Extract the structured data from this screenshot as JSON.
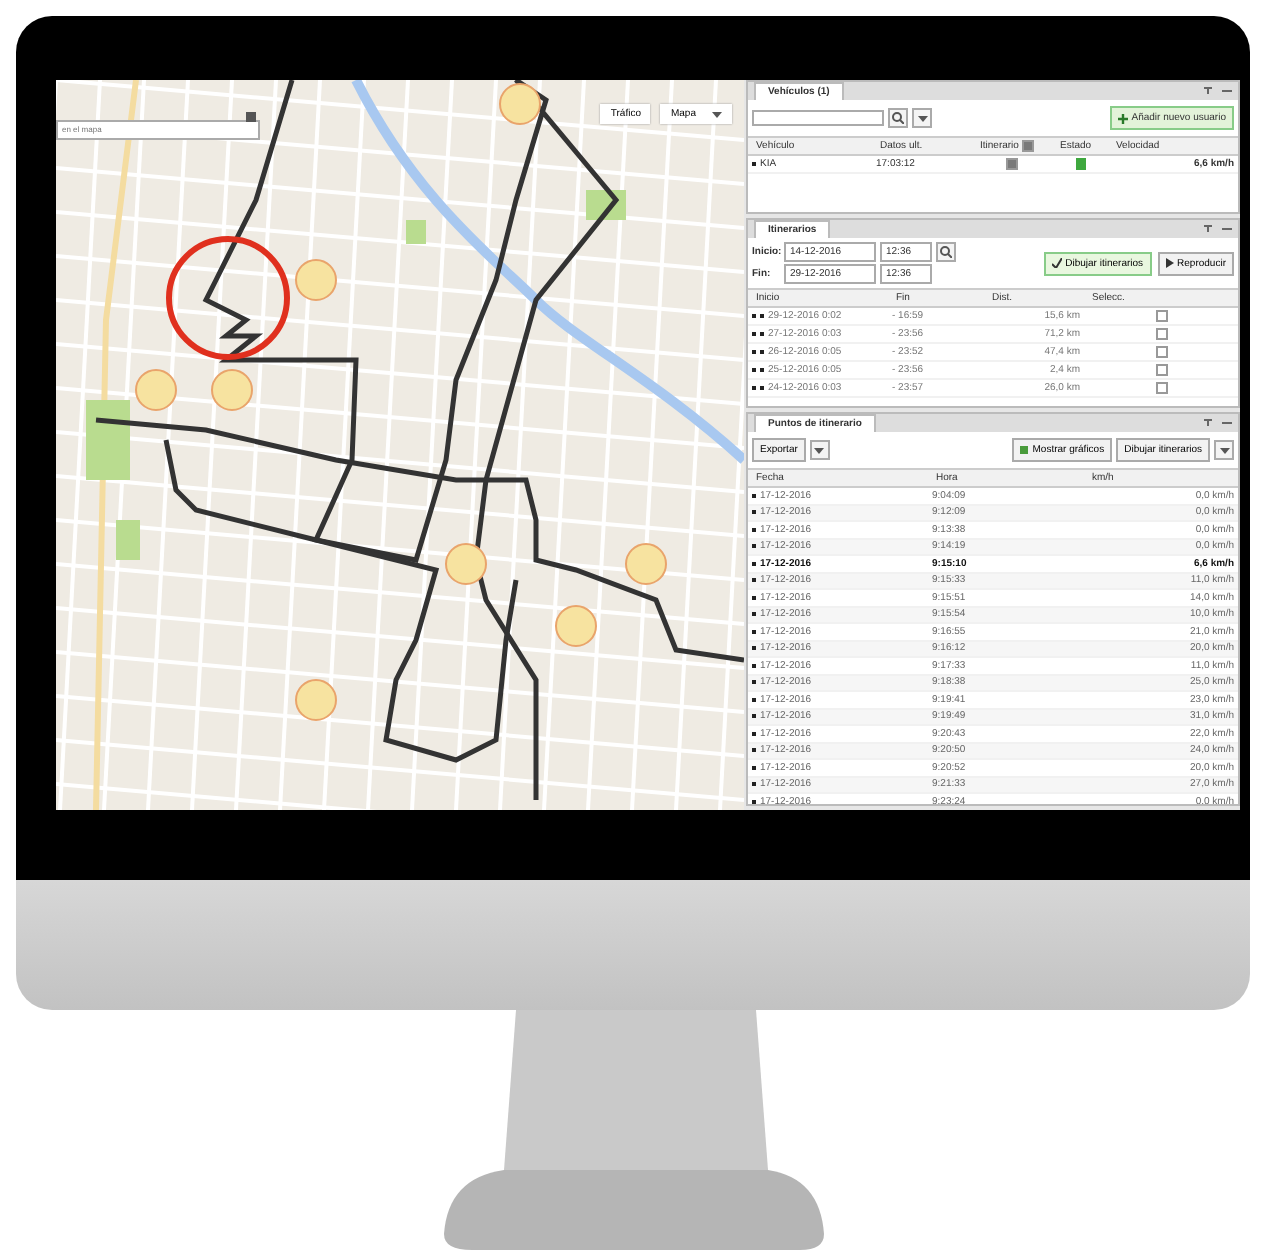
{
  "map": {
    "search": {
      "placeholder": "en el mapa"
    },
    "controls": [
      {
        "label": "Tráfico",
        "kind": "button"
      },
      {
        "label": "Mapa",
        "kind": "dropdown"
      }
    ]
  },
  "vehicles": {
    "title": "Vehículos (1)",
    "add_button": "Añadir nuevo usuario",
    "columns": [
      "Vehículo",
      "Datos ult.",
      "Itinerario",
      "Estado",
      "Velocidad"
    ],
    "itinerary_all_checked": true,
    "rows": [
      {
        "name": "KIA",
        "last_data": "17:03:12",
        "itinerary_checked": true,
        "speed": "6,6 km/h"
      }
    ]
  },
  "itineraries": {
    "title": "Itinerarios",
    "start_label": "Inicio:",
    "start_date": "14-12-2016",
    "start_time": "12:36",
    "end_label": "Fin:",
    "end_date": "29-12-2016",
    "end_time": "12:36",
    "draw_button": "Dibujar itinerarios",
    "play_button": "Reproducir",
    "columns": [
      "Inicio",
      "Fin",
      "Dist.",
      "Selecc."
    ],
    "rows": [
      {
        "start": "29-12-2016 0:02",
        "end": "- 16:59",
        "distance": "15,6 km",
        "checked": false
      },
      {
        "start": "27-12-2016 0:03",
        "end": "- 23:56",
        "distance": "71,2 km",
        "checked": false
      },
      {
        "start": "26-12-2016 0:05",
        "end": "- 23:52",
        "distance": "47,4 km",
        "checked": false
      },
      {
        "start": "25-12-2016 0:05",
        "end": "- 23:56",
        "distance": "2,4 km",
        "checked": false
      },
      {
        "start": "24-12-2016 0:03",
        "end": "- 23:57",
        "distance": "26,0 km",
        "checked": false
      }
    ]
  },
  "points": {
    "title": "Puntos de itinerario",
    "export_button": "Exportar",
    "charts_button": "Mostrar gráficos",
    "draw_button": "Dibujar itinerarios",
    "columns": [
      "Fecha",
      "Hora",
      "km/h"
    ],
    "rows": [
      {
        "date": "17-12-2016",
        "time": "9:04:09",
        "speed": "0,0 km/h",
        "selected": false
      },
      {
        "date": "17-12-2016",
        "time": "9:12:09",
        "speed": "0,0 km/h",
        "selected": false
      },
      {
        "date": "17-12-2016",
        "time": "9:13:38",
        "speed": "0,0 km/h",
        "selected": false
      },
      {
        "date": "17-12-2016",
        "time": "9:14:19",
        "speed": "0,0 km/h",
        "selected": false
      },
      {
        "date": "17-12-2016",
        "time": "9:15:10",
        "speed": "6,6 km/h",
        "selected": true
      },
      {
        "date": "17-12-2016",
        "time": "9:15:33",
        "speed": "11,0 km/h",
        "selected": false
      },
      {
        "date": "17-12-2016",
        "time": "9:15:51",
        "speed": "14,0 km/h",
        "selected": false
      },
      {
        "date": "17-12-2016",
        "time": "9:15:54",
        "speed": "10,0 km/h",
        "selected": false
      },
      {
        "date": "17-12-2016",
        "time": "9:16:55",
        "speed": "21,0 km/h",
        "selected": false
      },
      {
        "date": "17-12-2016",
        "time": "9:16:12",
        "speed": "20,0 km/h",
        "selected": false
      },
      {
        "date": "17-12-2016",
        "time": "9:17:33",
        "speed": "11,0 km/h",
        "selected": false
      },
      {
        "date": "17-12-2016",
        "time": "9:18:38",
        "speed": "25,0 km/h",
        "selected": false
      },
      {
        "date": "17-12-2016",
        "time": "9:19:41",
        "speed": "23,0 km/h",
        "selected": false
      },
      {
        "date": "17-12-2016",
        "time": "9:19:49",
        "speed": "31,0 km/h",
        "selected": false
      },
      {
        "date": "17-12-2016",
        "time": "9:20:43",
        "speed": "22,0 km/h",
        "selected": false
      },
      {
        "date": "17-12-2016",
        "time": "9:20:50",
        "speed": "24,0 km/h",
        "selected": false
      },
      {
        "date": "17-12-2016",
        "time": "9:20:52",
        "speed": "20,0 km/h",
        "selected": false
      },
      {
        "date": "17-12-2016",
        "time": "9:21:33",
        "speed": "27,0 km/h",
        "selected": false
      },
      {
        "date": "17-12-2016",
        "time": "9:23:24",
        "speed": "0,0 km/h",
        "selected": false
      }
    ]
  }
}
